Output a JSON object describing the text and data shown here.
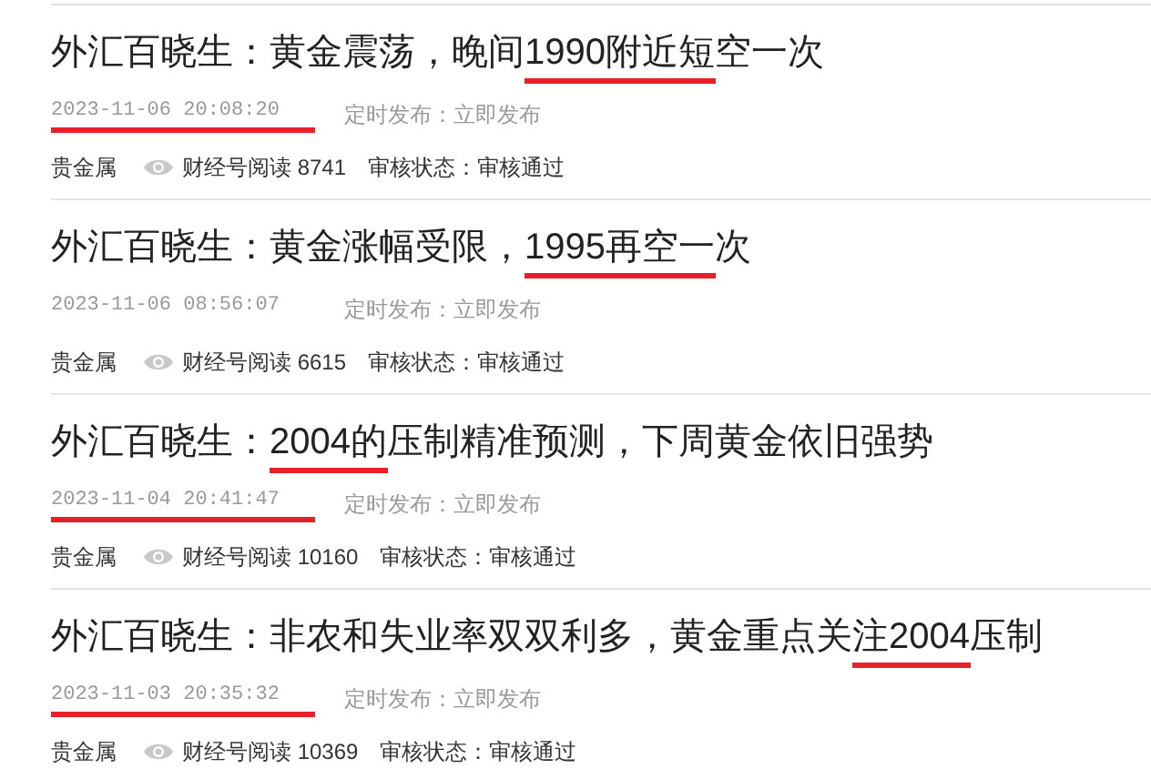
{
  "articles": [
    {
      "title": [
        {
          "text": "外汇百晓生：黄金震荡，晚间",
          "marked": false
        },
        {
          "text": "1990附近短",
          "marked": true
        },
        {
          "text": "空一次",
          "marked": false
        }
      ],
      "date": "2023-11-06 20:08:20",
      "date_marked": true,
      "publish": "定时发布：立即发布",
      "category": "贵金属",
      "reads": "财经号阅读 8741",
      "review": "审核状态：审核通过"
    },
    {
      "title": [
        {
          "text": "外汇百晓生：黄金涨幅受限，",
          "marked": false
        },
        {
          "text": "1995再空一",
          "marked": true
        },
        {
          "text": "次",
          "marked": false
        }
      ],
      "date": "2023-11-06 08:56:07",
      "date_marked": false,
      "publish": "定时发布：立即发布",
      "category": "贵金属",
      "reads": "财经号阅读 6615",
      "review": "审核状态：审核通过"
    },
    {
      "title": [
        {
          "text": "外汇百晓生：",
          "marked": false
        },
        {
          "text": "2004的",
          "marked": true
        },
        {
          "text": "压制精准预测，下周黄金依旧强势",
          "marked": false
        }
      ],
      "date": "2023-11-04 20:41:47",
      "date_marked": true,
      "publish": "定时发布：立即发布",
      "category": "贵金属",
      "reads": "财经号阅读 10160",
      "review": "审核状态：审核通过"
    },
    {
      "title": [
        {
          "text": "外汇百晓生：非农和失业率双双利多，黄金重点关",
          "marked": false
        },
        {
          "text": "注2004",
          "marked": true
        },
        {
          "text": "压制",
          "marked": false
        }
      ],
      "date": "2023-11-03 20:35:32",
      "date_marked": true,
      "publish": "定时发布：立即发布",
      "category": "贵金属",
      "reads": "财经号阅读 10369",
      "review": "审核状态：审核通过"
    }
  ]
}
